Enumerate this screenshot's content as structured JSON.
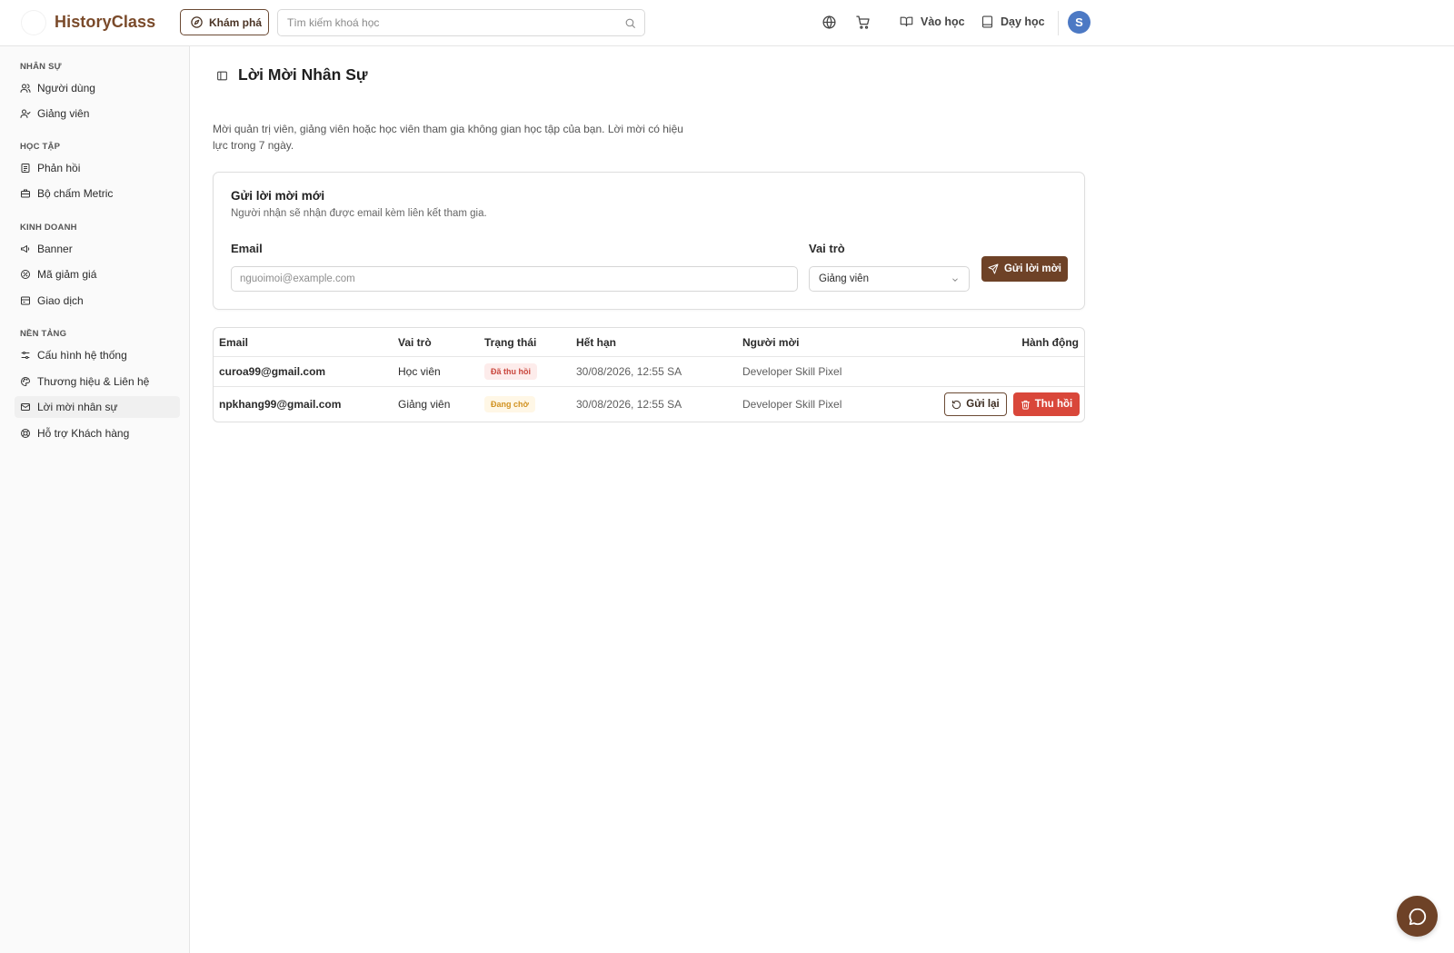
{
  "colors": {
    "brand": "#7a4a2a",
    "primary_button": "#6e4227",
    "danger_button": "#d9473a",
    "avatar": "#4c79c4",
    "badge_revoked": "#c9463c",
    "badge_pending": "#d19221"
  },
  "header": {
    "logo_text": "HistoryClass",
    "explore_label": "Khám phá",
    "explore_icon": "compass-icon",
    "search_placeholder": "Tìm kiếm khoá học",
    "search_icon": "search-icon",
    "language_icon": "globe-icon",
    "cart_icon": "cart-icon",
    "learn_label": "Vào học",
    "learn_icon": "open-book-icon",
    "teach_label": "Dạy học",
    "teach_icon": "book-icon",
    "avatar_initial": "S"
  },
  "sidebar": {
    "sections": [
      {
        "title": "NHÂN SỰ",
        "items": [
          {
            "label": "Người dùng",
            "icon": "users-icon"
          },
          {
            "label": "Giảng viên",
            "icon": "user-check-icon"
          }
        ]
      },
      {
        "title": "HỌC TẬP",
        "items": [
          {
            "label": "Phản hồi",
            "icon": "feedback-icon"
          },
          {
            "label": "Bộ chấm Metric",
            "icon": "briefcase-icon"
          }
        ]
      },
      {
        "title": "KINH DOANH",
        "items": [
          {
            "label": "Banner",
            "icon": "megaphone-icon"
          },
          {
            "label": "Mã giảm giá",
            "icon": "coupon-icon"
          },
          {
            "label": "Giao dịch",
            "icon": "transactions-icon"
          }
        ]
      },
      {
        "title": "NỀN TẢNG",
        "items": [
          {
            "label": "Cấu hình hệ thống",
            "icon": "sliders-icon"
          },
          {
            "label": "Thương hiệu & Liên hệ",
            "icon": "palette-icon"
          },
          {
            "label": "Lời mời nhân sự",
            "icon": "mail-icon",
            "active": true
          },
          {
            "label": "Hỗ trợ Khách hàng",
            "icon": "lifebuoy-icon"
          }
        ]
      }
    ]
  },
  "main": {
    "title": "Lời Mời Nhân Sự",
    "description": "Mời quản trị viên, giảng viên hoặc học viên tham gia không gian học tập của bạn. Lời mời có hiệu lực trong 7 ngày.",
    "form": {
      "title": "Gửi lời mời mới",
      "subtitle": "Người nhận sẽ nhận được email kèm liên kết tham gia.",
      "email_label": "Email",
      "email_placeholder": "nguoimoi@example.com",
      "role_label": "Vai trò",
      "role_value": "Giảng viên",
      "submit_label": "Gửi lời mời"
    },
    "table": {
      "headers": [
        "Email",
        "Vai trò",
        "Trạng thái",
        "Hết hạn",
        "Người mời",
        "Hành động"
      ],
      "rows": [
        {
          "email": "curoa99@gmail.com",
          "role": "Học viên",
          "status": "Đã thu hồi",
          "status_type": "revoked",
          "expires": "30/08/2026, 12:55 SA",
          "inviter": "Developer Skill Pixel"
        },
        {
          "email": "npkhang99@gmail.com",
          "role": "Giảng viên",
          "status": "Đang chờ",
          "status_type": "pending",
          "expires": "30/08/2026, 12:55 SA",
          "inviter": "Developer Skill Pixel",
          "actions": {
            "resend": "Gửi lại",
            "revoke": "Thu hồi"
          }
        }
      ]
    }
  },
  "chat_icon": "chat-bubble-icon"
}
